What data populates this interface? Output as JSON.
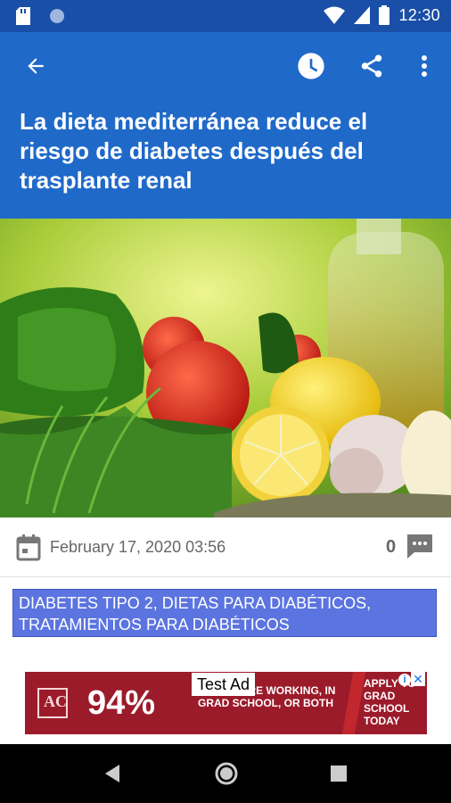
{
  "status_bar": {
    "time": "12:30",
    "icons": [
      "sd-card-icon",
      "circle-icon",
      "wifi-icon",
      "signal-icon",
      "battery-icon"
    ]
  },
  "app_bar": {
    "title": "La dieta mediterránea reduce el riesgo de diabetes después del trasplante renal",
    "actions": [
      "back-arrow-icon",
      "clock-icon",
      "share-icon",
      "more-vert-icon"
    ],
    "color": "#1f69c9"
  },
  "article": {
    "date": "February 17, 2020 03:56",
    "comment_count": "0",
    "categories": "DIABETES TIPO 2, DIETAS PARA DIABÉTICOS, TRATAMIENTOS PARA DIABÉTICOS"
  },
  "ad": {
    "label": "Test Ad",
    "logo": "AC",
    "percent": "94%",
    "text": "OF ADS ARE WORKING, IN GRAD SCHOOL, OR BOTH",
    "cta": "APPLY TO GRAD SCHOOL TODAY",
    "info": "i",
    "close": "✕"
  },
  "colors": {
    "status_bar": "#1a4fa7",
    "category_bg": "#5b74e0",
    "ad_bg": "#9b1b2a"
  }
}
